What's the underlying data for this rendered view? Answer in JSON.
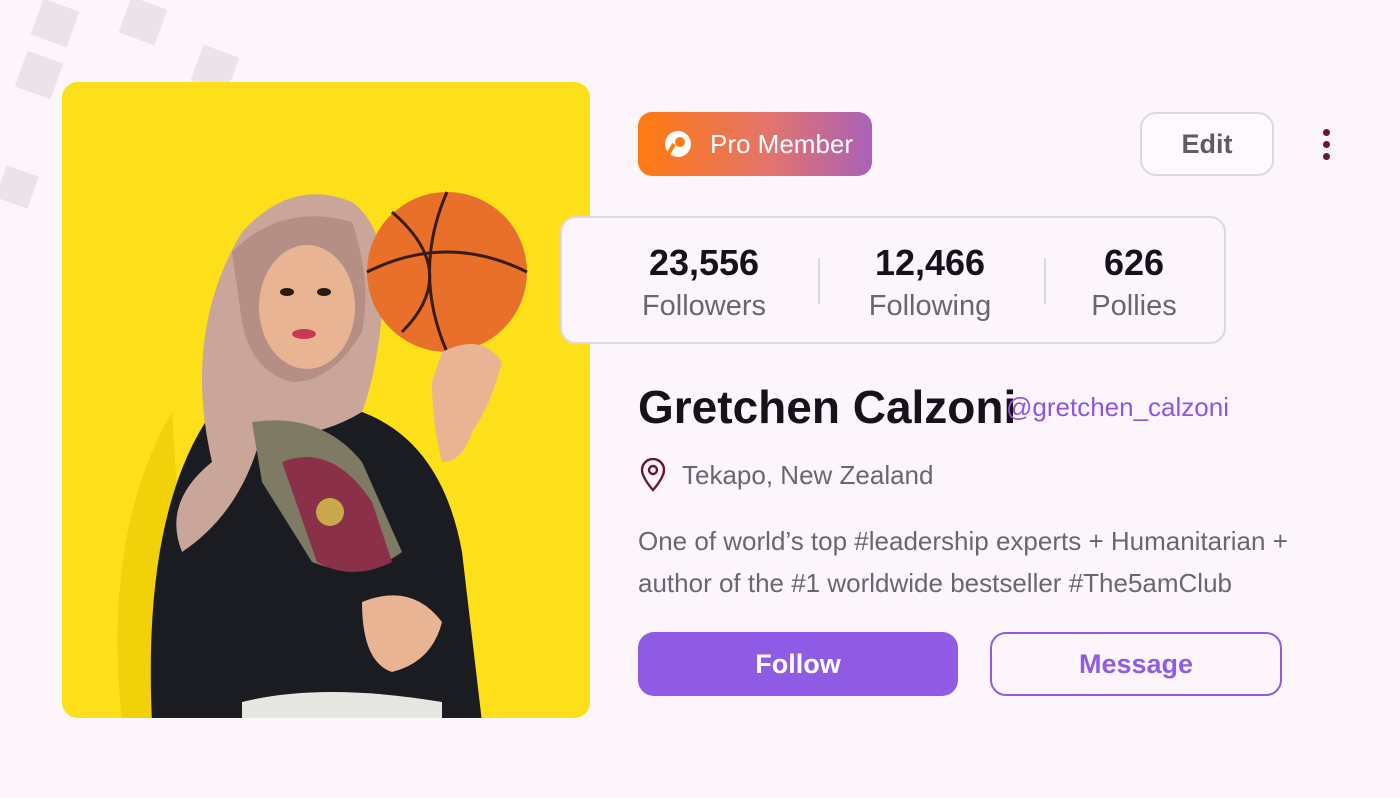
{
  "badge": {
    "label": "Pro Member",
    "icon": "pro-logo-icon"
  },
  "header": {
    "edit_label": "Edit",
    "more_icon": "more-vertical-icon"
  },
  "stats": [
    {
      "value": "23,556",
      "label": "Followers"
    },
    {
      "value": "12,466",
      "label": "Following"
    },
    {
      "value": "626",
      "label": "Pollies"
    }
  ],
  "profile": {
    "name": "Gretchen Calzoni",
    "handle": "@gretchen_calzoni",
    "location": "Tekapo, New Zealand",
    "location_icon": "map-pin-icon",
    "bio": "One of world’s top #leadership experts + Humanitarian + author of the #1 worldwide bestseller #The5amClub"
  },
  "actions": {
    "follow_label": "Follow",
    "message_label": "Message"
  },
  "colors": {
    "background": "#fcf6fc",
    "accent": "#8f5be4",
    "photo_background": "#fde01a",
    "badge_gradient_start": "#ff7a10",
    "badge_gradient_end": "#a862b8",
    "text_primary": "#16121c",
    "text_secondary": "#6a6671"
  }
}
